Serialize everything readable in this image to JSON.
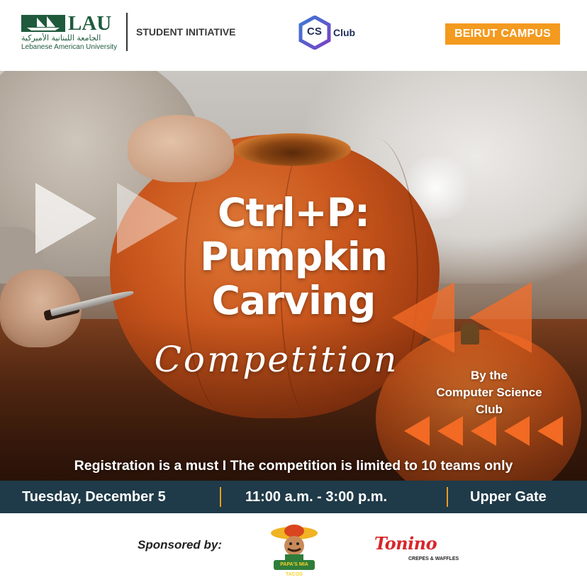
{
  "header": {
    "lau": {
      "abbr": "LAU",
      "arabic": "الجامعة اللبنانية الأميركية",
      "name": "Lebanese American University"
    },
    "initiative": "STUDENT INITIATIVE",
    "cs_club": {
      "abbr": "CS",
      "label": "Club"
    },
    "campus": "BEIRUT CAMPUS"
  },
  "title": {
    "line1": "Ctrl+P:",
    "line2": "Pumpkin",
    "line3": "Carving",
    "script": "Competition"
  },
  "byline": {
    "line1": "By the",
    "line2": "Computer Science",
    "line3": "Club"
  },
  "registration": "Registration is a must  I  The competition is limited to 10 teams only",
  "info": {
    "date": "Tuesday, December 5",
    "time": "11:00 a.m. - 3:00 p.m.",
    "location": "Upper Gate"
  },
  "sponsors": {
    "label": "Sponsored by:",
    "sponsor1": "PAPA'S MIA TACOS",
    "sponsor2": "Tonino",
    "sponsor2_sub": "CREPES & WAFFLES"
  },
  "colors": {
    "accent_orange": "#f39a1f",
    "info_bar": "#1f3a48",
    "lau_green": "#1f5a3d",
    "cs_navy": "#1e2d5a",
    "tonino_red": "#d7262a"
  }
}
